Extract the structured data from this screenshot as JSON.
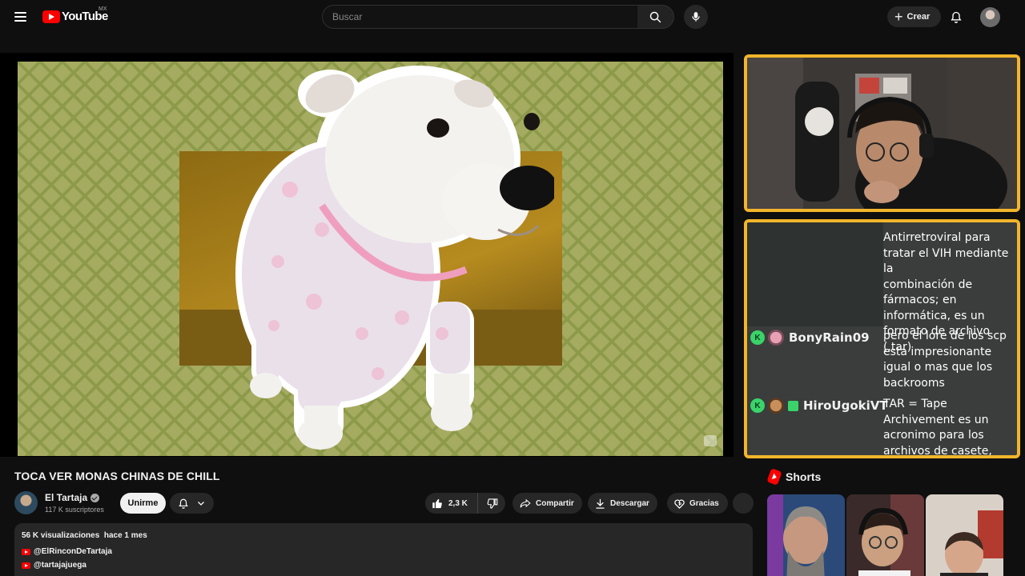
{
  "header": {
    "logo_text": "YouTube",
    "logo_region": "MX",
    "search_placeholder": "Buscar",
    "create_label": "Crear"
  },
  "video": {
    "title": "TOCA VER MONAS CHINAS DE CHILL"
  },
  "channel": {
    "name": "El Tartaja",
    "subscribers": "117 K suscriptores",
    "join_label": "Unirme"
  },
  "actions": {
    "likes": "2,3 K",
    "share_label": "Compartir",
    "download_label": "Descargar",
    "thanks_label": "Gracias"
  },
  "description": {
    "views": "56 K visualizaciones",
    "date": "hace 1 mes",
    "links": [
      "@ElRinconDeTartaja",
      "@tartajajuega"
    ]
  },
  "chat": {
    "messages": [
      {
        "lines": [
          "Antirretroviral para",
          "tratar el VIH mediante la",
          "combinación de",
          "fármacos; en",
          "informática, es un",
          "formato de archivo (.tar)"
        ]
      },
      {
        "user": "BonyRain09",
        "lines": [
          "pero el lore de los scp",
          "esta impresionante",
          "igual o mas que los",
          "backrooms"
        ]
      },
      {
        "user": "HiroUgokiVT",
        "lines": [
          "TAR = Tape",
          "Archivement es un",
          "acronimo para los",
          "archivos de casete,"
        ]
      }
    ],
    "badge_letter": "K"
  },
  "shorts": {
    "label": "Shorts"
  },
  "colors": {
    "accent_frame": "#f2b52b",
    "youtube_red": "#ff0000",
    "background": "#0f0f0f"
  },
  "icons": [
    "menu-icon",
    "youtube-logo-icon",
    "search-icon",
    "mic-icon",
    "plus-icon",
    "bell-icon",
    "verified-icon",
    "chevron-down-icon",
    "like-icon",
    "dislike-icon",
    "share-icon",
    "download-icon",
    "thanks-icon",
    "shorts-icon"
  ]
}
